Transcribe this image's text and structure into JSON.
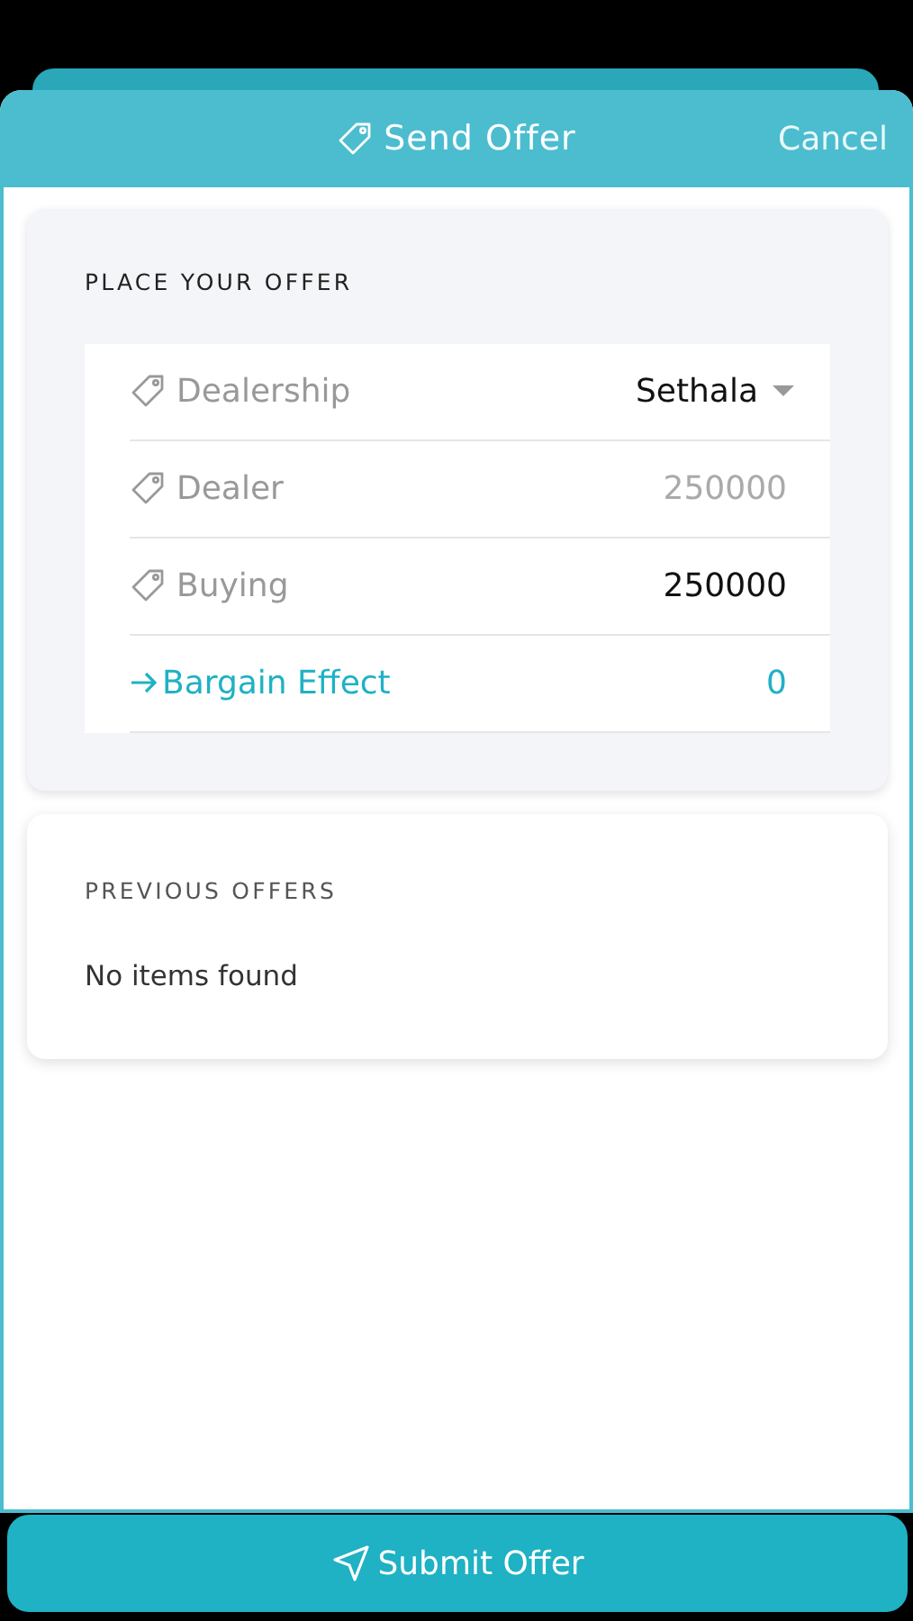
{
  "header": {
    "title": "Send Offer",
    "cancel": "Cancel"
  },
  "offer": {
    "heading": "PLACE YOUR OFFER",
    "rows": [
      {
        "kind": "select",
        "label": "Dealership",
        "value": "Sethala"
      },
      {
        "kind": "readonly",
        "label": "Dealer",
        "value": "250000"
      },
      {
        "kind": "input",
        "label": "Buying",
        "value": "250000"
      },
      {
        "kind": "result",
        "label": "Bargain Effect",
        "value": "0"
      }
    ]
  },
  "previous": {
    "heading": "PREVIOUS OFFERS",
    "empty": "No items found"
  },
  "submit": "Submit Offer"
}
